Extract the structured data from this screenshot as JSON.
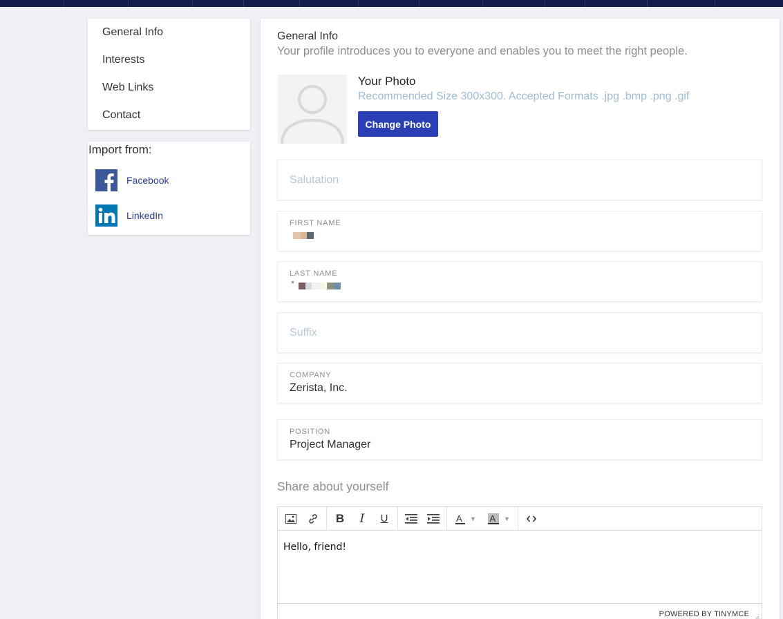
{
  "sidebar": {
    "nav_items": [
      {
        "label": "General Info"
      },
      {
        "label": "Interests"
      },
      {
        "label": "Web Links"
      },
      {
        "label": "Contact"
      }
    ],
    "import": {
      "title": "Import from:",
      "sources": [
        {
          "label": "Facebook",
          "icon": "facebook-icon"
        },
        {
          "label": "LinkedIn",
          "icon": "linkedin-icon"
        }
      ]
    }
  },
  "main": {
    "title": "General Info",
    "subtitle": "Your profile introduces you to everyone and enables you to meet the right people.",
    "photo": {
      "label": "Your Photo",
      "hint": "Recommended Size 300x300. Accepted Formats .jpg .bmp .png .gif",
      "button": "Change Photo"
    },
    "fields": {
      "salutation": {
        "placeholder": "Salutation"
      },
      "first_name": {
        "label": "FIRST NAME"
      },
      "last_name": {
        "label": "LAST NAME"
      },
      "suffix": {
        "placeholder": "Suffix"
      },
      "company": {
        "label": "COMPANY",
        "value": "Zerista, Inc."
      },
      "position": {
        "label": "POSITION",
        "value": "Project Manager"
      }
    },
    "share": {
      "label": "Share about yourself",
      "content": "Hello, friend!",
      "powered_by": "POWERED BY TINYMCE"
    }
  },
  "colors": {
    "accent": "#2a3fb3",
    "topbar": "#141a4a",
    "link": "#2a3a9c",
    "hint": "#9dbcd6",
    "facebook": "#3b5998",
    "linkedin": "#0077b5"
  }
}
